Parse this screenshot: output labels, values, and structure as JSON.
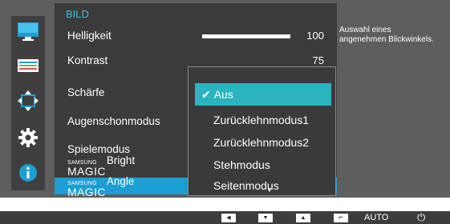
{
  "menu": {
    "title": "BILD",
    "items": [
      {
        "label": "Helligkeit",
        "value": "100",
        "level": 100
      },
      {
        "label": "Kontrast",
        "value": "75"
      },
      {
        "label": "Schärfe"
      },
      {
        "label": "Augenschonmodus"
      },
      {
        "label": "Spielemodus"
      },
      {
        "brand_top": "SAMSUNG",
        "brand_bottom": "MAGIC",
        "label": "Bright"
      },
      {
        "brand_top": "SAMSUNG",
        "brand_bottom": "MAGIC",
        "label": "Angle",
        "selected": true
      }
    ]
  },
  "dropdown": {
    "selected": "Aus",
    "options": [
      "Aus",
      "Zurücklehnmodus1",
      "Zurücklehnmodus2",
      "Stehmodus",
      "Seitenmodus"
    ],
    "more_indicator": "▼"
  },
  "help_text": "Auswahl eines angenehmen Blickwinkels.",
  "sidebar_icons": [
    "monitor-icon",
    "picture-settings-icon",
    "resize-arrows-icon",
    "gear-icon",
    "info-icon"
  ],
  "bottom_bar": {
    "buttons": [
      "left-arrow-button",
      "down-arrow-button",
      "up-arrow-button",
      "enter-button"
    ],
    "auto_label": "AUTO",
    "power_symbol": "⏻"
  },
  "colors": {
    "osd_background": "#5e5e5e",
    "menu_background": "#3b3b3b",
    "title_color": "#49b8e6",
    "selected_item": "#1d9ed4",
    "dropdown_highlight": "#2bb3bf"
  }
}
